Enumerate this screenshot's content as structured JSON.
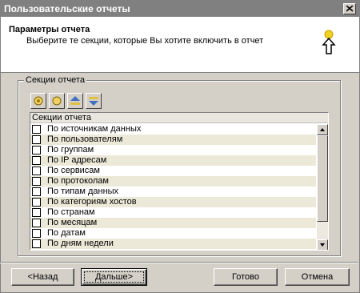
{
  "window": {
    "title": "Пользовательские отчеты"
  },
  "header": {
    "title": "Параметры отчета",
    "subtitle": "Выберите те секции, которые Вы хотите включить в отчет"
  },
  "group": {
    "legend": "Секции отчета",
    "toolbar": [
      "select-all-icon",
      "deselect-all-icon",
      "move-up-icon",
      "move-down-icon"
    ]
  },
  "list": {
    "column_header": "Секции отчета",
    "items": [
      {
        "label": "По источникам данных",
        "checked": false
      },
      {
        "label": "По пользователям",
        "checked": false
      },
      {
        "label": "По группам",
        "checked": false
      },
      {
        "label": "По IP адресам",
        "checked": false
      },
      {
        "label": "По сервисам",
        "checked": false
      },
      {
        "label": "По протоколам",
        "checked": false
      },
      {
        "label": "По типам данных",
        "checked": false
      },
      {
        "label": "По категориям хостов",
        "checked": false
      },
      {
        "label": "По странам",
        "checked": false
      },
      {
        "label": "По месяцам",
        "checked": false
      },
      {
        "label": "По датам",
        "checked": false
      },
      {
        "label": "По дням недели",
        "checked": false
      },
      {
        "label": "",
        "checked": false
      }
    ]
  },
  "buttons": {
    "back": "<Назад",
    "next": "Дальше>",
    "finish": "Готово",
    "cancel": "Отмена"
  }
}
